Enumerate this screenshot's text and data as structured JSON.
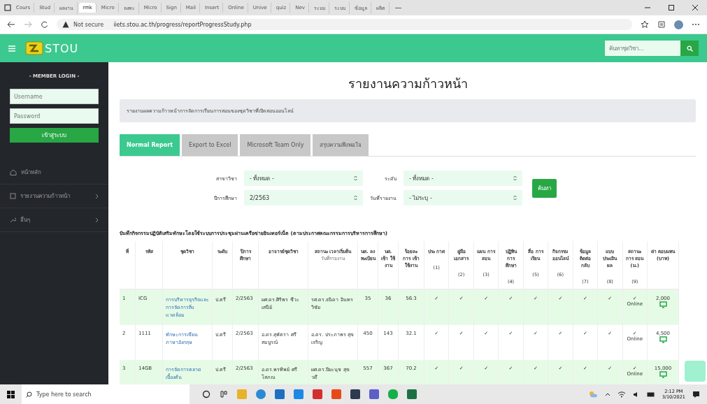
{
  "browser": {
    "tabs": [
      {
        "title": "Cours",
        "selected": false
      },
      {
        "title": "Stud",
        "selected": false
      },
      {
        "title": "ผลงาน",
        "selected": false
      },
      {
        "title": "rmk",
        "selected": true
      },
      {
        "title": "Micro",
        "selected": false
      },
      {
        "title": "ลงทะ",
        "selected": false
      },
      {
        "title": "Micro",
        "selected": false
      },
      {
        "title": "Sign",
        "selected": false
      },
      {
        "title": "Mail",
        "selected": false
      },
      {
        "title": "Insert",
        "selected": false
      },
      {
        "title": "Online",
        "selected": false
      },
      {
        "title": "Unive",
        "selected": false
      },
      {
        "title": "quiz",
        "selected": false
      },
      {
        "title": "Nev",
        "selected": false
      },
      {
        "title": "ระบบ",
        "selected": false
      },
      {
        "title": "ระบบ",
        "selected": false
      },
      {
        "title": "ข้อมูล",
        "selected": false
      },
      {
        "title": "ผลิต",
        "selected": false
      }
    ],
    "address": {
      "security": "Not secure",
      "url": "iiets.stou.ac.th/progress/reportProgressStudy.php"
    }
  },
  "header": {
    "logo": "STOU",
    "search": {
      "placeholder": "ค้นหาชุดวิชา..."
    }
  },
  "sidebar": {
    "login_title": "- MEMBER LOGIN -",
    "username": {
      "placeholder": "Username"
    },
    "password": {
      "placeholder": "Password"
    },
    "login_button": "เข้าสู่ระบบ",
    "menu": [
      {
        "label": "หน้าหลัก",
        "kind": "home",
        "has_submenu": false
      },
      {
        "label": "รายงานความก้าวหน้า",
        "kind": "report",
        "has_submenu": true
      },
      {
        "label": "อื่นๆ",
        "kind": "tools",
        "has_submenu": true
      }
    ]
  },
  "page": {
    "title": "รายงานความก้าวหน้า",
    "notice": "รายงานผลความก้าวหน้าการจัดการเรียนการสอนของชุดวิชาที่เปิดสอนออนไลน์",
    "tabs": [
      {
        "label": "Normal Report",
        "selected": true
      },
      {
        "label": "Export to Excel",
        "selected": false
      },
      {
        "label": "Microsoft Team Only",
        "selected": false
      },
      {
        "label": "สรุปความพึงพอใจ",
        "selected": false
      }
    ],
    "filters": [
      {
        "label": "สาขาวิชา",
        "value": "- ทั้งหมด -"
      },
      {
        "label": "ระดับ",
        "value": "- ทั้งหมด -"
      },
      {
        "label": "ปีการศึกษา",
        "value": "2/2563"
      },
      {
        "label": "วันที่รายงาน",
        "value": "- ไม่ระบุ -"
      }
    ],
    "search_button": "ค้นหา",
    "caption": "บันทึกกิจกรรมปฏิบัติเสริมทักษะโดยใช้ระบบการประชุมผ่านเครือข่ายอินเทอร์เน็ต (ตามประกาศคณะกรรมการบริหารการศึกษา)"
  },
  "table": {
    "columns": [
      {
        "label": "ที่"
      },
      {
        "label": "รหัส"
      },
      {
        "label": "ชุดวิชา"
      },
      {
        "label": "ระดับ"
      },
      {
        "label": "ปีการศึกษา"
      },
      {
        "label": "อาจารย์ชุดวิชา"
      },
      {
        "label": "สถานะ เวลาเริ่มต้น",
        "sub": "วันที่รายงาน"
      },
      {
        "label": "นศ. ลง ทะเบียน"
      },
      {
        "label": "นศ. เข้า ใช้ งาน"
      },
      {
        "label": "ร้อยละ การ เข้า ใช้งาน"
      },
      {
        "label": "ประ กาศ",
        "number": "(1)"
      },
      {
        "label": "คู่มือ เอกสาร",
        "number": "(2)"
      },
      {
        "label": "แผน การ สอน",
        "number": "(3)"
      },
      {
        "label": "ปฏิทิน การ ศึกษา",
        "number": "(4)"
      },
      {
        "label": "สื่อ การ เรียน",
        "number": "(5)"
      },
      {
        "label": "กิจกรรม ออนไลน์",
        "number": "(6)"
      },
      {
        "label": "ข้อมูล ติดต่อ กลับ",
        "number": "(7)"
      },
      {
        "label": "แบบ ประเมิน ผล",
        "number": "(8)"
      },
      {
        "label": "สถานะ การ สอน (ม.)",
        "number": "(9)"
      },
      {
        "label": "ค่า ตอบแทน (บาท)"
      }
    ],
    "rows": [
      {
        "no": "1",
        "code": "ICG",
        "course": "การบริหารธุรกิจและการจัดการสิ่งแวดล้อม",
        "level": "ป.ตรี",
        "term": "2/2563",
        "instructor": "ผศ.ดร.ศิริพร ชีวะเสนีย์",
        "status": "รศ.ดร.ธนิดา อินทรวิชัย",
        "enrolled": "35",
        "attended": "36",
        "percent": "56.3",
        "checks": [
          "✓",
          "✓",
          "✓",
          "✓",
          "✓",
          "✓",
          "✓",
          "✓"
        ],
        "mark": "✓",
        "mark_note": "Online",
        "fee": "2,000"
      },
      {
        "no": "2",
        "code": "1111",
        "course": "ทักษะการเขียนภาษาอังกฤษ",
        "level": "ป.ตรี",
        "term": "2/2563",
        "instructor": "อ.ดร.สุพัตรา ศรีสมบูรณ์",
        "status": "อ.ดร. ประภาพร สุขเจริญ",
        "enrolled": "450",
        "attended": "143",
        "percent": "32.1",
        "checks": [
          "✓",
          "✓",
          "✓",
          "✓",
          "✓",
          "✓",
          "✓",
          "✓"
        ],
        "mark": "✓",
        "mark_note": "Online",
        "fee": "4,500"
      },
      {
        "no": "3",
        "code": "14GB",
        "course": "การจัดการตลาดเบื้องต้น",
        "level": "ป.ตรี",
        "term": "2/2563",
        "instructor": "อ.ดร.พรทิพย์ ศรีโสภณ",
        "status": "ผศ.ดร.ปิยะนุช สุขวดี",
        "enrolled": "557",
        "attended": "367",
        "percent": "70.2",
        "checks": [
          "✓",
          "✓",
          "✓",
          "✓",
          "✓",
          "✓",
          "✓",
          "✓"
        ],
        "mark": "✓",
        "mark_note": "Online",
        "fee": "15,000"
      }
    ]
  },
  "taskbar": {
    "search_placeholder": "Type here to search",
    "time": "2:12 PM",
    "date": "3/10/2021"
  }
}
